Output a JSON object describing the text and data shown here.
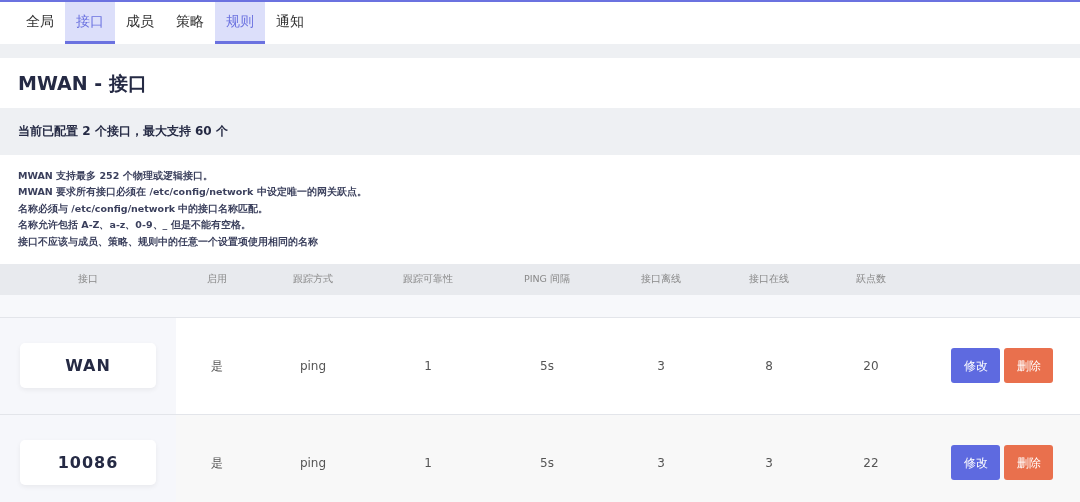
{
  "tabs": [
    {
      "label": "全局",
      "selected": false
    },
    {
      "label": "接口",
      "selected": true
    },
    {
      "label": "成员",
      "selected": false
    },
    {
      "label": "策略",
      "selected": false
    },
    {
      "label": "规则",
      "selected": true
    },
    {
      "label": "通知",
      "selected": false
    }
  ],
  "page_title": "MWAN - 接口",
  "section_title": "当前已配置 2 个接口，最大支持 60 个",
  "description": [
    "MWAN 支持最多 252 个物理或逻辑接口。",
    "MWAN 要求所有接口必须在 /etc/config/network 中设定唯一的网关跃点。",
    "名称必须与 /etc/config/network 中的接口名称匹配。",
    "名称允许包括 A-Z、a-z、0-9、_ 但是不能有空格。",
    "接口不应该与成员、策略、规则中的任意一个设置项使用相同的名称"
  ],
  "table": {
    "columns": [
      "接口",
      "启用",
      "跟踪方式",
      "跟踪可靠性",
      "PING 间隔",
      "接口离线",
      "接口在线",
      "跃点数"
    ],
    "rows": [
      {
        "cells": [
          "WAN",
          "是",
          "ping",
          "1",
          "5s",
          "3",
          "8",
          "20"
        ],
        "buttons": [
          "修改",
          "删除"
        ]
      },
      {
        "cells": [
          "10086",
          "是",
          "ping",
          "1",
          "5s",
          "3",
          "3",
          "22"
        ],
        "buttons": [
          "修改",
          "删除"
        ]
      }
    ]
  }
}
